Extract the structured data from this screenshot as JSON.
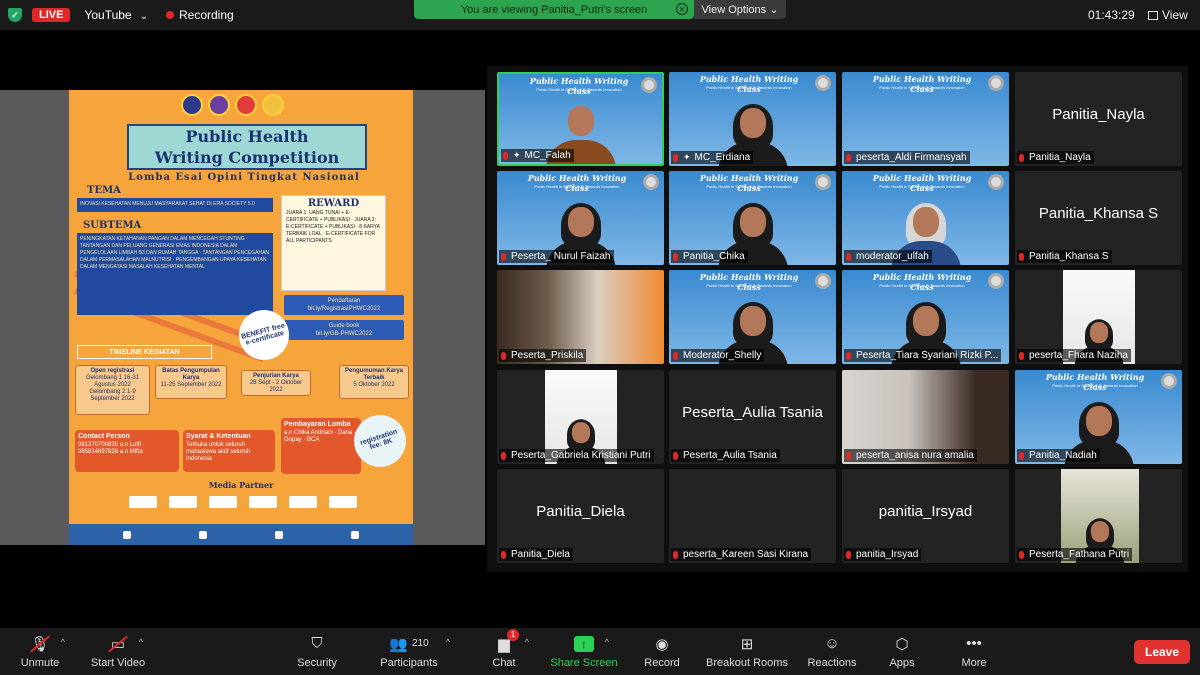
{
  "topbar": {
    "live": "LIVE",
    "platform": "YouTube",
    "recording": "Recording",
    "viewing_banner": "You are viewing Panitia_Putri's screen",
    "view_options": "View Options",
    "time": "01:43:29",
    "view": "View"
  },
  "poster": {
    "title": "Public Health\nWriting Competition",
    "subtitle": "Lomba Esai Opini Tingkat Nasional",
    "tema_label": "TEMA",
    "tema": "INOVASI KESEHATAN MENUJU MASYARAKAT SEHAT DI ERA SOCIETY 5.0",
    "subtema_label": "SUBTEMA",
    "subtema": "PENINGKATAN KETAHANAN PANGAN DALAM MENCEGAH STUNTING · TANTANGAN DAN PELUANG GENERASI EMAS INDONESIA DALAM PENGELOLAAN LIMBAH B3 DAN RUMAH TANGGA · TANTANGAN PENCEGAHAN DALAM PERMASALAHAN MALNUTRISI · PENGEMBANGAN UPAYA KESEHATAN DALAM MENGATASI MASALAH KESEHATAN MENTAL",
    "reward_title": "REWARD",
    "reward_text": "JUARA 1: UANG TUNAI + E-CERTIFICATE + PUBLIKASI · JUARA 2: E-CERTIFICATE + PUBLIKASI · 8 KARYA TERBAIK LOAL · E-CERTIFICATE FOR ALL PARTICIPANTS",
    "pendaftaran": "Pendaftaran",
    "reg_link": "bit.ly/RegistrasiPHWC2022",
    "guide": "Guide book",
    "guide_link": "bit.ly/GB-PHWC2022",
    "benefit": "BENEFIT free e-certificate",
    "timeline": "TIMELINE KEGIATAN",
    "open_reg": "Open registrasi",
    "open_reg_dates": "Gelombang 1 16-31 Agustus 2022 Gelombang 2 1-9 September 2022",
    "batas": "Batas Pengumpulan Karya",
    "batas_dates": "11-25 September 2022",
    "penjurian": "Penjurian Karya",
    "penjurian_dates": "26 Sept - 2 Oktober 2022",
    "pengumuman": "Pengumuman Karya Terbaik",
    "pengumuman_date": "5 Oktober 2022",
    "contact": "Contact Person",
    "contact_text": "081370700835 a.n Lutfi · 085814697838 a.n Mifta",
    "syarat": "Syarat & Ketentuan",
    "syarat_text": "Terbuka untuk seluruh mahasiswa aktif seluruh Indonesia",
    "pembayaran": "Pembayaran Lomba",
    "pembayaran_text": "a.n Chika Andriani · Dana · Gopay · BCA",
    "regfee": "registration fee: 8K",
    "media_partner": "Media Partner"
  },
  "tiles": [
    {
      "name": "MC_Falah",
      "type": "video",
      "pinned": true
    },
    {
      "name": "MC_Erdiana",
      "type": "video",
      "pinned": true
    },
    {
      "name": "peserta_Aldi Firmansyah",
      "type": "video"
    },
    {
      "name": "Panitia_Nayla",
      "type": "text"
    },
    {
      "name": "Peserta_ Nurul Faizah",
      "type": "video"
    },
    {
      "name": "Panitia_Chika",
      "type": "video"
    },
    {
      "name": "moderator_ulfah",
      "type": "video"
    },
    {
      "name": "Panitia_Khansa S",
      "type": "text"
    },
    {
      "name": "Peserta_Priskila",
      "type": "video"
    },
    {
      "name": "Moderator_Shelly",
      "type": "video"
    },
    {
      "name": "Peserta_Tiara Syariani Rizki P...",
      "type": "video"
    },
    {
      "name": "peserta_Fhara Naziha",
      "type": "video"
    },
    {
      "name": "Peserta_Gabriela Kristiani Putri",
      "type": "video"
    },
    {
      "name": "Peserta_Aulia Tsania",
      "type": "text"
    },
    {
      "name": "peserta_anisa nura amalia",
      "type": "video"
    },
    {
      "name": "Panitia_Nadiah",
      "type": "video"
    },
    {
      "name": "Panitia_Diela",
      "type": "text"
    },
    {
      "name": "peserta_Kareen Sasi Kirana",
      "type": "empty"
    },
    {
      "name": "panitia_Irsyad",
      "type": "text"
    },
    {
      "name": "Peserta_Fathana Putri",
      "type": "video"
    }
  ],
  "banner_title": "Public Health Writing Class",
  "banner_sub": "Public Health in Society 5.0: Towards Innovation",
  "toolbar": {
    "unmute": "Unmute",
    "start_video": "Start Video",
    "security": "Security",
    "participants": "Participants",
    "participants_count": "210",
    "chat": "Chat",
    "chat_badge": "1",
    "share_screen": "Share Screen",
    "record": "Record",
    "breakout": "Breakout Rooms",
    "reactions": "Reactions",
    "apps": "Apps",
    "more": "More",
    "leave": "Leave"
  }
}
